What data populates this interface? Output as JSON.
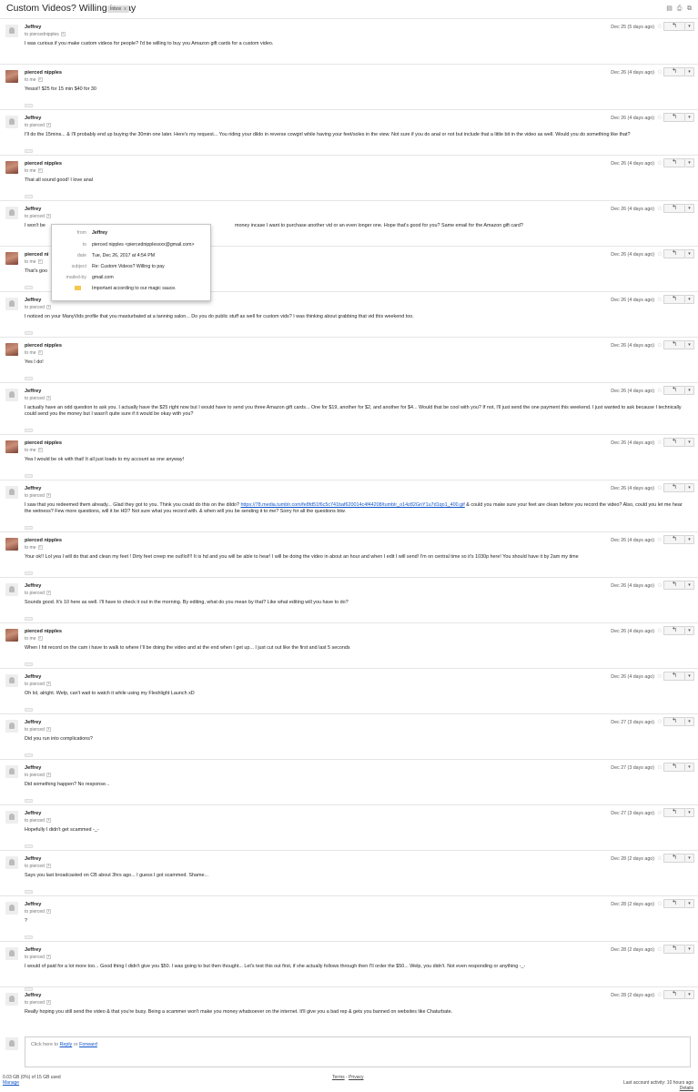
{
  "thread": {
    "subject": "Custom Videos? Willing to pay",
    "label": "Inbox",
    "label_close": "x"
  },
  "top_icons": [
    "archive-icon",
    "print-icon",
    "new-window-icon"
  ],
  "messages": [
    {
      "sender": "Jeffrey",
      "to": "to piercednipples",
      "date": "Dec 25 (5 days ago)",
      "avatar": "generic",
      "body": "I was curious if you make custom videos for people? I'd be willing to buy you Amazon gift cards for a custom video."
    },
    {
      "sender": "pierced nipples",
      "to": "to me",
      "date": "Dec 26 (4 days ago)",
      "avatar": "photo",
      "body": "Yesss!! $25 for 15 min $40 for 30"
    },
    {
      "sender": "Jeffrey",
      "to": "to pierced",
      "date": "Dec 26 (4 days ago)",
      "avatar": "generic",
      "body": "I'll do the 15mins... & I'll probably end up buying the 30min one later. Here's my request... You riding your dildo in reverse cowgirl while having your feet/soles in the view. Not sure if you do anal or not but include that a little bit in the video as well. Would you do something like that?"
    },
    {
      "sender": "pierced nipples",
      "to": "to me",
      "date": "Dec 26 (4 days ago)",
      "avatar": "photo",
      "body": "That all sound good! I love anal"
    },
    {
      "sender": "Jeffrey",
      "to": "to pierced",
      "date": "Dec 26 (4 days ago)",
      "avatar": "generic",
      "body_left": "I won't be",
      "body_right": "money incase I want to purchase another vid or an even longer one. Hope that's good for you? Same email for the Amazon gift card?"
    },
    {
      "sender": "pierced ni",
      "to": "to me",
      "date": "Dec 26 (4 days ago)",
      "avatar": "photo",
      "body": "That's goo"
    },
    {
      "sender": "Jeffrey",
      "to": "to pierced",
      "date": "Dec 26 (4 days ago)",
      "avatar": "generic",
      "body": "I noticed on your ManyVids profile that you masturbated at a tanning salon... Do you do public stuff as well for custom vids? I was thinking about grabbing that vid this weekend too."
    },
    {
      "sender": "pierced nipples",
      "to": "to me",
      "date": "Dec 26 (4 days ago)",
      "avatar": "photo",
      "body": "Yes I do!"
    },
    {
      "sender": "Jeffrey",
      "to": "to pierced",
      "date": "Dec 26 (4 days ago)",
      "avatar": "generic",
      "body": "I actually have an odd question to ask you. I actually have the $25 right now but I would have to send you three Amazon gift cards... One for $19, another for $2, and another for $4... Would that be cool with you? If not, I'll just send the one payment this weekend. I just wanted to ask because I technically could send you the money but I wasn't quite sure if it would be okay with you?"
    },
    {
      "sender": "pierced nipples",
      "to": "to me",
      "date": "Dec 26 (4 days ago)",
      "avatar": "photo",
      "body": "Yea I would be ok with that! It all just loads to my account as one anyway!"
    },
    {
      "sender": "Jeffrey",
      "to": "to pierced",
      "date": "Dec 26 (4 days ago)",
      "avatar": "generic",
      "body_before": "I saw that you redeemed them already... Glad they got to you. Think you could do this on the dildo? ",
      "link": "https://78.media.tumblr.com/fe8fd51f6c5c741baf620014c4f44208/tumblr_o14z82GnY1u7d1qo1_400.gif",
      "body_after": " & could you make sure your feet are clean before you record the video? Also, could you let me hear the wetness? Few more questions, will it be HD? Not sure what you record with. & when will you be sending it to me? Sorry for all the questions btw."
    },
    {
      "sender": "pierced nipples",
      "to": "to me",
      "date": "Dec 26 (4 days ago)",
      "avatar": "photo",
      "body": "Your ok!! Lol yea I will do that and clean my feet ! Dirty feet creep me out!lol!!! It is hd and you will be able to hear! I will be doing the video in about an hour and when I edit I will send! I'm on central time so it's 1030p here! You should have it by 2am my time"
    },
    {
      "sender": "Jeffrey",
      "to": "to pierced",
      "date": "Dec 26 (4 days ago)",
      "avatar": "generic",
      "body": "Sounds good. It's 10 here as well. I'll have to check it out in the morning. By editing, what do you mean by that? Like what editing will you have to do?"
    },
    {
      "sender": "pierced nipples",
      "to": "to me",
      "date": "Dec 26 (4 days ago)",
      "avatar": "photo",
      "body": "When I hit record on the cam i have to walk to where I'll be doing the video and at the end when I get up... I just cut out like the first and last 5 seconds"
    },
    {
      "sender": "Jeffrey",
      "to": "to pierced",
      "date": "Dec 26 (4 days ago)",
      "avatar": "generic",
      "body": "Oh lol, alright. Welp, can't wait to watch it while using my Fleshlight Launch xD"
    },
    {
      "sender": "Jeffrey",
      "to": "to pierced",
      "date": "Dec 27 (3 days ago)",
      "avatar": "generic",
      "body": "Did you run into complications?"
    },
    {
      "sender": "Jeffrey",
      "to": "to pierced",
      "date": "Dec 27 (3 days ago)",
      "avatar": "generic",
      "body": "Did something happen? No response..."
    },
    {
      "sender": "Jeffrey",
      "to": "to pierced",
      "date": "Dec 27 (3 days ago)",
      "avatar": "generic",
      "body": "Hopefully I didn't get scammed -_-"
    },
    {
      "sender": "Jeffrey",
      "to": "to pierced",
      "date": "Dec 28 (2 days ago)",
      "avatar": "generic",
      "body": "Says you last broadcasted on CB about 3hrs ago... I guess I got scammed. Shame..."
    },
    {
      "sender": "Jeffrey",
      "to": "to pierced",
      "date": "Dec 28 (2 days ago)",
      "avatar": "generic",
      "body": "?"
    },
    {
      "sender": "Jeffrey",
      "to": "to pierced",
      "date": "Dec 28 (2 days ago)",
      "avatar": "generic",
      "body": "I would of paid for a lot more too... Good thing I didn't give you $50. I was going to but then thought... Let's test this out first, if she actually follows through then I'll order the $50... Welp, you didn't. Not even responding or anything -_-"
    },
    {
      "sender": "Jeffrey",
      "to": "to pierced",
      "date": "Dec 28 (2 days ago)",
      "avatar": "generic",
      "body": "Really hoping you still send the video & that you're busy. Being a scammer won't make you money whatsoever on the internet. It'll give you a bad rep & gets you banned on websites like Chaturbate."
    }
  ],
  "details_popup": {
    "rows": [
      {
        "label": "from",
        "value": "Jeffrey"
      },
      {
        "label": "to",
        "value": "pierced nipples <piercednipplesxxx@gmail.com>"
      },
      {
        "label": "date",
        "value": "Tue, Dec 26, 2017 at 4:54 PM"
      },
      {
        "label": "subject",
        "value": "Re: Custom Videos? Willing to pay"
      },
      {
        "label": "mailed-by",
        "value": "gmail.com"
      }
    ],
    "important_text": "Important according to our magic sauce."
  },
  "reply_box": {
    "prefix": "Click here to ",
    "reply": "Reply",
    "or": " or ",
    "forward": "Forward"
  },
  "footer": {
    "storage": "0.03 GB (0%) of 15 GB used",
    "manage": "Manage",
    "terms": "Terms",
    "sep": " - ",
    "privacy": "Privacy",
    "activity": "Last account activity: 10 hours ago",
    "details": "Details"
  }
}
